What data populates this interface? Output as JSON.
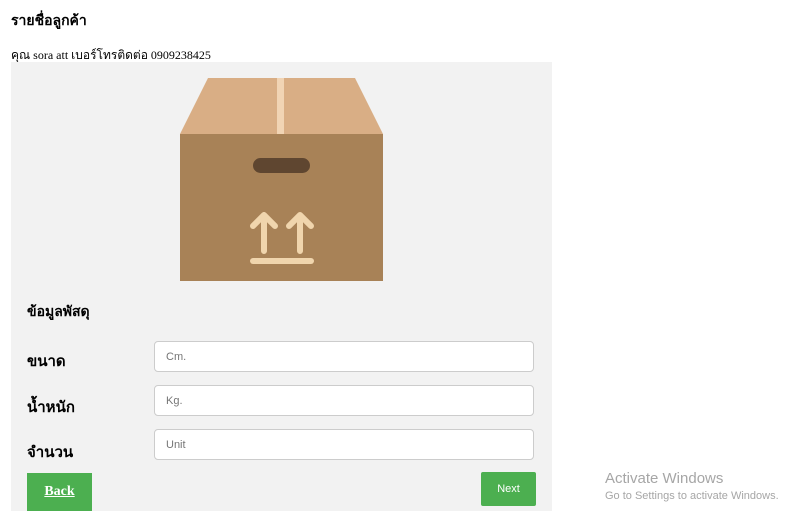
{
  "header": {
    "title": "รายชื่อลูกค้า"
  },
  "customer": {
    "line": "คุณ sora att เบอร์โทรติดต่อ 0909238425"
  },
  "illustration": {
    "icon": "shipping-box-icon"
  },
  "form": {
    "section_title": "ข้อมูลพัสดุ",
    "fields": [
      {
        "label": "ขนาด",
        "placeholder": "Cm.",
        "value": ""
      },
      {
        "label": "น้ำหนัก",
        "placeholder": "Kg.",
        "value": ""
      },
      {
        "label": "จำนวน",
        "placeholder": "Unit",
        "value": ""
      }
    ]
  },
  "buttons": {
    "back": "Back",
    "next": "Next"
  },
  "colors": {
    "button": "#4caf50",
    "panel": "#f2f2f2",
    "box_front": "#a88257",
    "box_lid": "#d9ae85"
  },
  "watermark": {
    "title": "Activate Windows",
    "subtitle": "Go to Settings to activate Windows."
  }
}
